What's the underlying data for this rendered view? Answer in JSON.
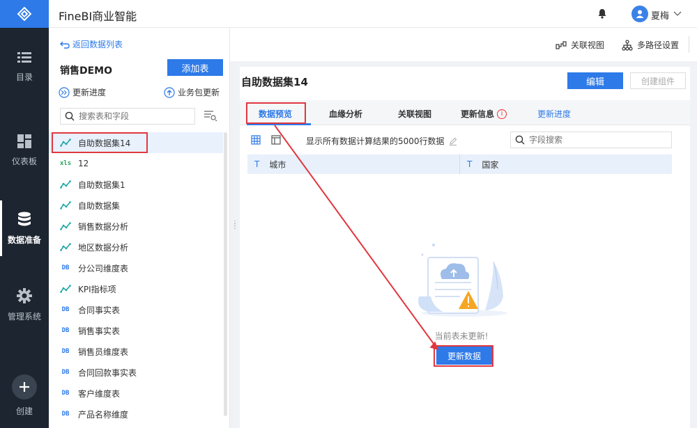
{
  "app": {
    "title": "FineBI商业智能"
  },
  "user": {
    "name": "夏梅"
  },
  "nav": {
    "items": [
      {
        "label": "目录",
        "icon": "list-icon"
      },
      {
        "label": "仪表板",
        "icon": "dashboard-icon"
      },
      {
        "label": "数据准备",
        "icon": "database-icon",
        "active": true
      },
      {
        "label": "管理系统",
        "icon": "gear-icon"
      }
    ],
    "create_label": "创建"
  },
  "left_panel": {
    "back_label": "返回数据列表",
    "package_title": "销售DEMO",
    "add_table_label": "添加表",
    "update_progress_label": "更新进度",
    "package_update_label": "业务包更新",
    "search_placeholder": "搜索表和字段",
    "tables": [
      {
        "name": "自助数据集14",
        "type": "self"
      },
      {
        "name": "12",
        "type": "excel"
      },
      {
        "name": "自助数据集1",
        "type": "self"
      },
      {
        "name": "自助数据集",
        "type": "self"
      },
      {
        "name": "销售数据分析",
        "type": "self"
      },
      {
        "name": "地区数据分析",
        "type": "self"
      },
      {
        "name": "分公司维度表",
        "type": "db"
      },
      {
        "name": "KPI指标项",
        "type": "self"
      },
      {
        "name": "合同事实表",
        "type": "db"
      },
      {
        "name": "销售事实表",
        "type": "db"
      },
      {
        "name": "销售员维度表",
        "type": "db"
      },
      {
        "name": "合同回款事实表",
        "type": "db"
      },
      {
        "name": "客户维度表",
        "type": "db"
      },
      {
        "name": "产品名称维度",
        "type": "db"
      }
    ],
    "type_tags": {
      "excel": "xls",
      "db": "DB"
    }
  },
  "header": {
    "relation_view_label": "关联视图",
    "multipath_label": "多路径设置"
  },
  "dataset": {
    "title": "自助数据集14",
    "edit_label": "编辑",
    "create_component_label": "创建组件",
    "tabs": [
      "数据预览",
      "血缘分析",
      "关联视图",
      "更新信息"
    ],
    "update_progress_link": "更新进度",
    "info_mark": "i",
    "preview_note": "显示所有数据计算结果的5000行数据",
    "field_search_placeholder": "字段搜索",
    "columns": [
      {
        "type": "T",
        "name": "城市"
      },
      {
        "type": "T",
        "name": "国家"
      }
    ],
    "empty_text": "当前表未更新!",
    "update_data_label": "更新数据"
  },
  "colors": {
    "accent": "#2d7ae8",
    "annotation": "#e0373f",
    "nav_bg": "#1d2530"
  }
}
